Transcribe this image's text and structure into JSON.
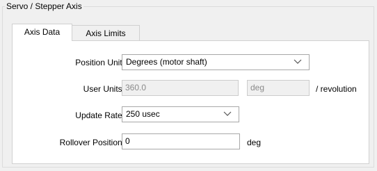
{
  "group": {
    "title": "Servo / Stepper Axis"
  },
  "tabs": [
    {
      "label": "Axis Data",
      "selected": true
    },
    {
      "label": "Axis Limits",
      "selected": false
    }
  ],
  "form": {
    "position_unit": {
      "label": "Position Unit:",
      "value": "Degrees (motor shaft)"
    },
    "user_units": {
      "label": "User Units:",
      "value": "360.0",
      "unit": "deg",
      "suffix": "/ revolution"
    },
    "update_rate": {
      "label": "Update Rate:",
      "value": "250 usec"
    },
    "rollover_position": {
      "label": "Rollover Position:",
      "value": "0",
      "unit": "deg"
    }
  },
  "icons": {
    "dropdown": "chevron-down-icon"
  },
  "colors": {
    "panel": "#ffffff",
    "window": "#f0f0f0",
    "border": "#a8a8a8",
    "disabled_text": "#8a8a8a"
  }
}
